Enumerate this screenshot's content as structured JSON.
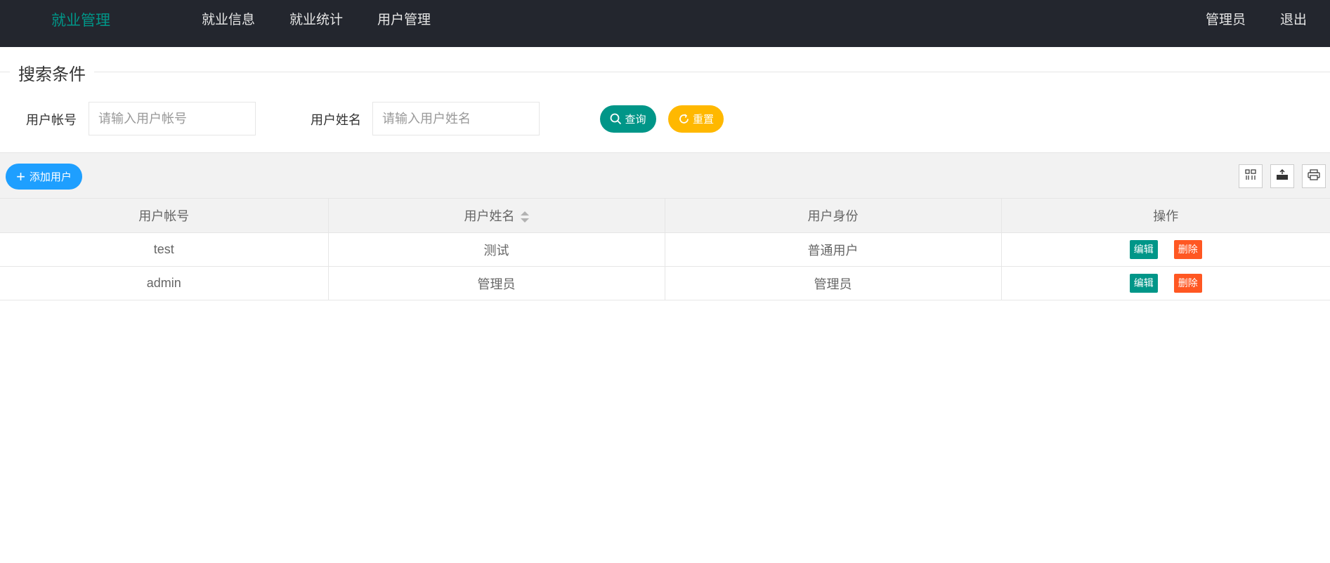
{
  "header": {
    "brand": "就业管理",
    "nav": [
      "就业信息",
      "就业统计",
      "用户管理"
    ],
    "right": [
      "管理员",
      "退出"
    ]
  },
  "search": {
    "legend": "搜索条件",
    "account_label": "用户帐号",
    "account_placeholder": "请输入用户帐号",
    "name_label": "用户姓名",
    "name_placeholder": "请输入用户姓名",
    "search_button": "查询",
    "reset_button": "重置"
  },
  "toolbar": {
    "add_button": "添加用户",
    "icons": [
      "columns-icon",
      "export-icon",
      "print-icon"
    ]
  },
  "table": {
    "headers": [
      "用户帐号",
      "用户姓名",
      "用户身份",
      "操作"
    ],
    "rows": [
      {
        "account": "test",
        "name": "测试",
        "role": "普通用户",
        "edit": "编辑",
        "delete": "删除"
      },
      {
        "account": "admin",
        "name": "管理员",
        "role": "管理员",
        "edit": "编辑",
        "delete": "删除"
      }
    ]
  },
  "colors": {
    "nav_bg": "#23262e",
    "brand": "#009688",
    "search_button": "#009688",
    "reset_button": "#ffb800",
    "add_button": "#1e9fff",
    "delete_button": "#ff5722"
  }
}
